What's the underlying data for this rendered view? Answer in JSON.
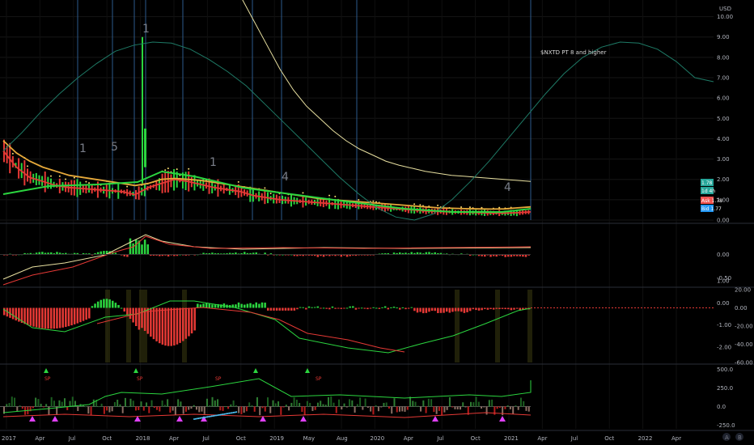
{
  "chart_data": [
    {
      "type": "line",
      "title": "",
      "annotation": "$NXTD PT 8 and higher",
      "currency": "USD",
      "y_ticks": [
        "0.00",
        "1.00",
        "2.00",
        "3.00",
        "4.00",
        "5.00",
        "6.00",
        "7.00",
        "8.00",
        "9.00",
        "10.00"
      ],
      "ylim": [
        0,
        10.5
      ],
      "price_tags": [
        {
          "label": "1.78",
          "color": "#26a69a"
        },
        {
          "label": "1d 4h",
          "color": "#26a69a"
        },
        {
          "label": "Ask",
          "value": "1.78",
          "color": "#ef5350"
        },
        {
          "label": "Bid",
          "value": "1.77",
          "color": "#2196f3"
        }
      ],
      "series": [
        {
          "color": "#e53935",
          "values": [
            3.4,
            2.6,
            2.1,
            1.9,
            1.7,
            1.6,
            1.55,
            1.5,
            1.45,
            1.4,
            1.25,
            1.6,
            1.8,
            2.0,
            1.9,
            1.75,
            1.6,
            1.5,
            1.4,
            1.2,
            1.1,
            1.0,
            0.95,
            0.9,
            0.85,
            0.8,
            0.75,
            0.7,
            0.65,
            0.6,
            0.55,
            0.5,
            0.45,
            0.42,
            0.4,
            0.38,
            0.36,
            0.35,
            0.34,
            0.36,
            0.4
          ]
        },
        {
          "color": "#e6a93a",
          "values": [
            3.9,
            3.3,
            2.9,
            2.6,
            2.4,
            2.2,
            2.1,
            2.0,
            1.9,
            1.8,
            1.7,
            1.8,
            2.0,
            2.05,
            2.0,
            1.95,
            1.85,
            1.75,
            1.65,
            1.55,
            1.45,
            1.35,
            1.25,
            1.15,
            1.05,
            1.0,
            0.95,
            0.9,
            0.85,
            0.8,
            0.75,
            0.7,
            0.65,
            0.6,
            0.58,
            0.56,
            0.55,
            0.54,
            0.55,
            0.6,
            0.65
          ]
        },
        {
          "color": "#e8e0a0",
          "values": [
            null,
            null,
            null,
            null,
            null,
            null,
            null,
            null,
            null,
            null,
            null,
            null,
            null,
            null,
            null,
            null,
            null,
            null,
            11.0,
            9.8,
            8.6,
            7.4,
            6.4,
            5.6,
            5.0,
            4.4,
            3.9,
            3.5,
            3.2,
            2.9,
            2.7,
            2.55,
            2.4,
            2.3,
            2.2,
            2.15,
            2.1,
            2.05,
            2.0,
            1.95,
            1.9
          ]
        },
        {
          "color": "#1e7a66",
          "values": [
            3.4,
            4.3,
            5.3,
            6.2,
            7.0,
            7.7,
            8.3,
            8.6,
            8.75,
            8.7,
            8.4,
            7.9,
            7.3,
            6.6,
            5.7,
            4.8,
            3.9,
            3.0,
            2.1,
            1.3,
            0.6,
            0.15,
            0.0,
            0.3,
            1.0,
            1.9,
            2.9,
            4.0,
            5.1,
            6.2,
            7.2,
            8.0,
            8.5,
            8.75,
            8.7,
            8.4,
            7.8,
            7.0,
            6.8
          ]
        }
      ],
      "cycle_labels": [
        "1",
        "5",
        "1",
        "1",
        "4",
        "4"
      ]
    },
    {
      "type": "bar",
      "y_ticks": [
        "0.00",
        "-0.50"
      ],
      "ylim": [
        -0.65,
        0.6
      ]
    },
    {
      "type": "bar",
      "y_ticks": [
        "20.00",
        "0.00",
        "-20.00",
        "-40.00",
        "-60.00"
      ],
      "secondary_ticks": [
        "1.00",
        "0.00",
        "-1.00",
        "-2.00"
      ],
      "ylim": [
        -60,
        20
      ]
    },
    {
      "type": "bar",
      "y_ticks": [
        "500.0",
        "250.0",
        "0.0",
        "-250.0"
      ],
      "ylim": [
        -300,
        550
      ],
      "marker_labels": [
        "SP",
        "SP",
        "SP",
        "SP"
      ]
    }
  ],
  "x_axis": {
    "labels": [
      "2017",
      "Apr",
      "Jul",
      "Oct",
      "2018",
      "Apr",
      "Jul",
      "Oct",
      "2019",
      "May",
      "Aug",
      "2020",
      "Apr",
      "Jul",
      "Oct",
      "2021",
      "Apr",
      "Jul",
      "Oct",
      "2022",
      "Apr"
    ]
  },
  "watermark_buttons": [
    "A",
    "B"
  ],
  "colors": {
    "background": "#000000",
    "bull": "#2bd53f",
    "bear": "#e53935",
    "vertical_lines": "#2c5a8c",
    "grid": "#161616",
    "text": "#b2b5be"
  }
}
